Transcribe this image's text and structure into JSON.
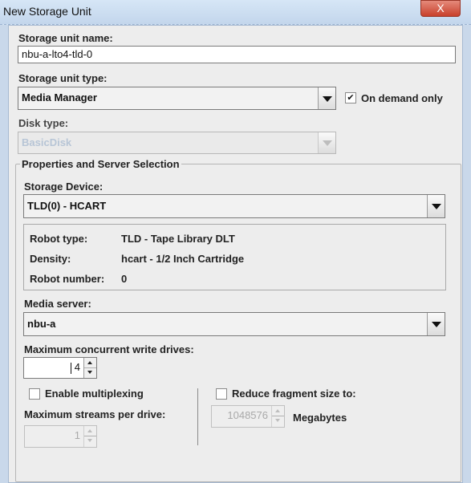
{
  "window": {
    "title": "New Storage Unit",
    "close_glyph": "X"
  },
  "fields": {
    "unit_name": {
      "label": "Storage unit name:",
      "value": "nbu-a-lto4-tld-0"
    },
    "unit_type": {
      "label": "Storage unit type:",
      "value": "Media Manager"
    },
    "on_demand": {
      "label": "On demand only",
      "checked": true,
      "check_glyph": "✔"
    },
    "disk_type": {
      "label": "Disk type:",
      "value": "BasicDisk"
    }
  },
  "properties": {
    "title": "Properties and Server Selection",
    "storage_device": {
      "label": "Storage Device:",
      "value": "TLD(0) - HCART"
    },
    "info": [
      {
        "key": "Robot type:",
        "value": "TLD - Tape Library DLT"
      },
      {
        "key": "Density:",
        "value": "hcart - 1/2 Inch Cartridge"
      },
      {
        "key": "Robot number:",
        "value": "0"
      }
    ],
    "media_server": {
      "label": "Media server:",
      "value": "nbu-a"
    },
    "max_write_drives": {
      "label": "Maximum concurrent write drives:",
      "value": "4"
    },
    "multiplexing": {
      "label": "Enable multiplexing",
      "checked": false
    },
    "max_streams": {
      "label": "Maximum streams per drive:",
      "value": "1"
    },
    "fragment": {
      "label": "Reduce fragment size to:",
      "checked": false,
      "value": "1048576",
      "unit": "Megabytes"
    }
  }
}
